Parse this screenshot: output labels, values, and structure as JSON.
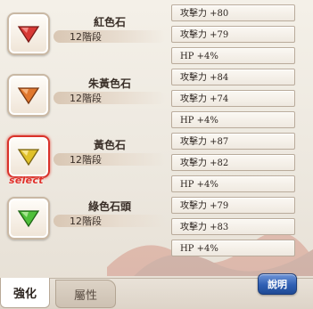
{
  "gems": [
    {
      "name": "紅色石",
      "stage": "12階段",
      "color": "#d83a36",
      "icon": "red-gem-icon",
      "selected": false
    },
    {
      "name": "朱黃色石",
      "stage": "12階段",
      "color": "#e0782e",
      "icon": "orange-gem-icon",
      "selected": false
    },
    {
      "name": "黃色石",
      "stage": "12階段",
      "color": "#e0c12a",
      "icon": "yellow-gem-icon",
      "selected": true
    },
    {
      "name": "綠色石頭",
      "stage": "12階段",
      "color": "#4fbf3a",
      "icon": "green-gem-icon",
      "selected": false
    }
  ],
  "select_label": "select",
  "stats": [
    "攻擊力 +80",
    "攻擊力 +79",
    "HP +4%",
    "攻擊力 +84",
    "攻擊力 +74",
    "HP +4%",
    "攻擊力 +87",
    "攻擊力 +82",
    "HP +4%",
    "攻擊力 +79",
    "攻擊力 +83",
    "HP +4%"
  ],
  "tabs": {
    "active": "強化",
    "inactive": "屬性"
  },
  "help_button": "說明",
  "colors": {
    "select": "#e0302a",
    "help_button": "#2f5fb3"
  }
}
